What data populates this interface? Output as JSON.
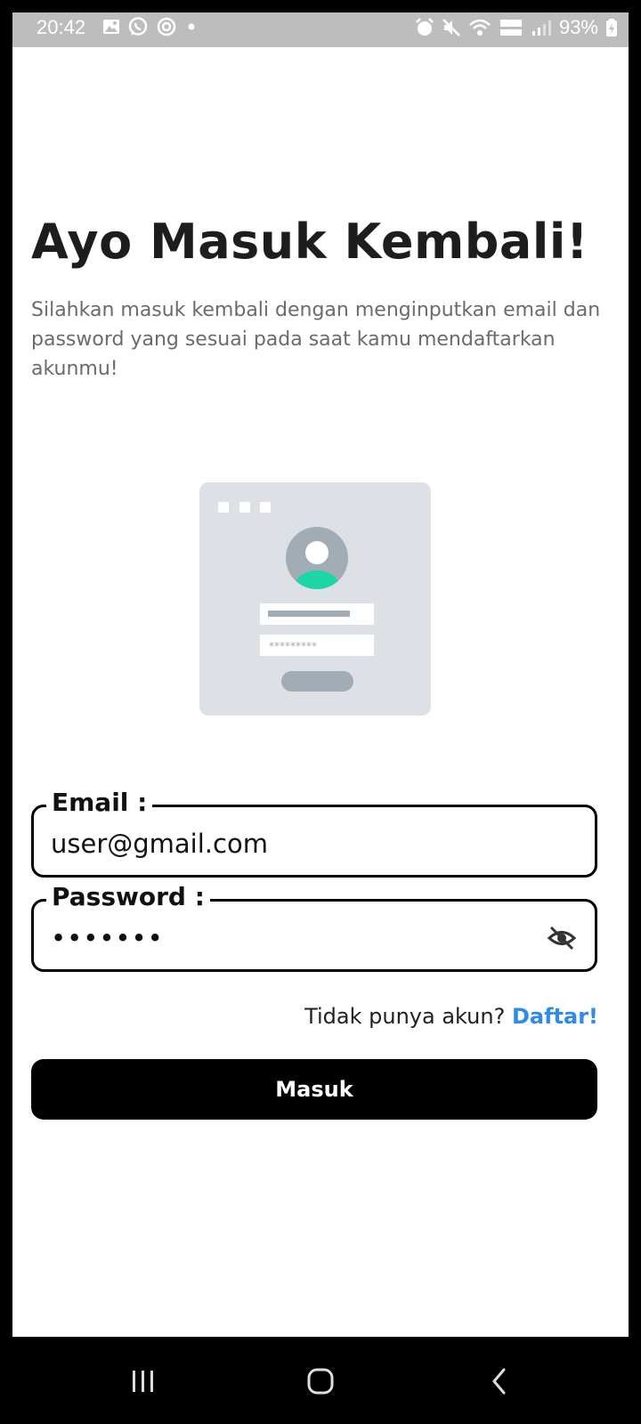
{
  "status_bar": {
    "time": "20:42",
    "battery": "93%",
    "left_icons": [
      "gallery-icon",
      "whatsapp-icon",
      "sync-icon",
      "dot-icon"
    ],
    "right_icons": [
      "alarm-icon",
      "mute-icon",
      "wifi-icon",
      "volte-icon",
      "signal-icon",
      "battery-charging-icon"
    ]
  },
  "header": {
    "title": "Ayo Masuk Kembali!",
    "subtitle": "Silahkan masuk kembali dengan menginputkan email dan password yang sesuai pada saat kamu mendaftarkan akunmu!"
  },
  "illustration": {
    "password_mask": "*********",
    "colors": {
      "card": "#dde1e6",
      "avatar": "#a2acb4",
      "accent": "#1ed5a8"
    }
  },
  "form": {
    "email": {
      "label": "Email :",
      "value": "user@gmail.com"
    },
    "password": {
      "label": "Password :",
      "value": "•••••••",
      "toggle_icon": "eye-off-icon"
    }
  },
  "signup": {
    "prompt": "Tidak punya akun?",
    "link": "Daftar!"
  },
  "login_button": {
    "label": "Masuk"
  },
  "nav_bar": {
    "buttons": [
      "recent-apps-icon",
      "home-icon",
      "back-icon"
    ]
  }
}
